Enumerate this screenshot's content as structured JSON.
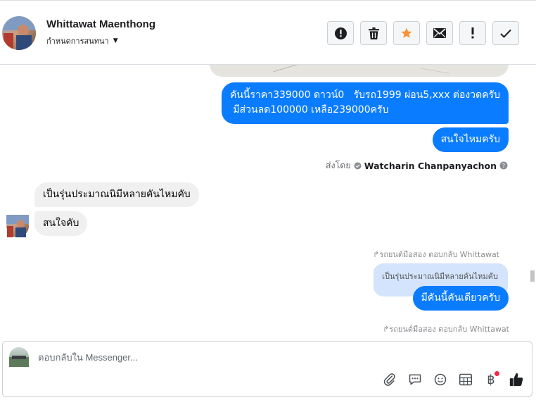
{
  "header": {
    "contact_name": "Whittawat Maenthong",
    "assign_label": "กำหนดการสนทนา",
    "actions": [
      "spam",
      "delete",
      "star",
      "mark-unread",
      "follow-up",
      "done"
    ]
  },
  "thread": {
    "messages": [
      {
        "from": "page",
        "text": "คันนี้ราคา339000 ดาวน์0   รับรถ1999 ผ่อน5,xxx ต่องวดครับ\n มีส่วนลด100000 เหลือ239000ครับ"
      },
      {
        "from": "page",
        "text": "สนใจไหมครับ"
      },
      {
        "from": "user",
        "text": "เป็นรุ่นประมาณนิมีหลายคันไหมคับ"
      },
      {
        "from": "user",
        "text": "สนใจคับ"
      },
      {
        "from": "page",
        "text": "มีคันนี้คันเดียวครับ"
      }
    ],
    "sent_by_prefix": "ส่งโดย",
    "sent_by_name": "Watcharin Chanpanyachon",
    "reply_meta_1": "รถยนต์มือสอง ตอบกลับ Whittawat",
    "quoted_text": "เป็นรุ่นประมาณนิมีหลายคันไหมคับ",
    "reply_meta_2": "รถยนต์มือสอง ตอบกลับ Whittawat"
  },
  "composer": {
    "placeholder": "ตอบกลับใน Messenger...",
    "value": "",
    "tools": [
      "attachment",
      "saved-reply",
      "emoji",
      "template",
      "payment",
      "like"
    ]
  },
  "colors": {
    "outgoing_bubble": "#0a7cff",
    "incoming_bubble": "#f0f0f0",
    "star": "#f7923a",
    "notification_dot": "#f02849"
  }
}
